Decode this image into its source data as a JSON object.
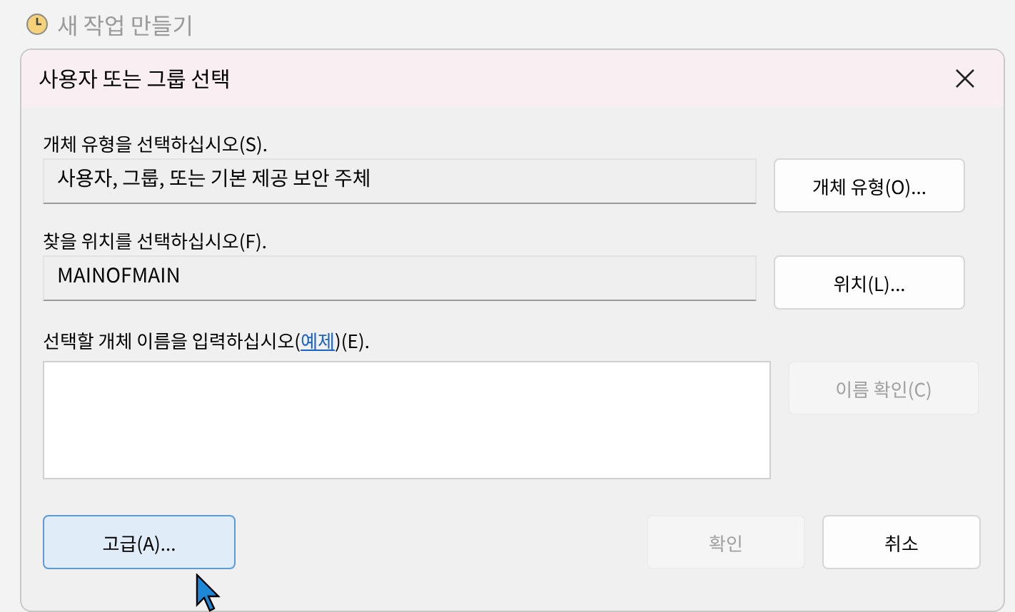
{
  "background_window": {
    "title": "새 작업 만들기"
  },
  "dialog": {
    "title": "사용자 또는 그룹 선택",
    "object_type": {
      "label": "개체 유형을 선택하십시오(S).",
      "value": "사용자, 그룹, 또는 기본 제공 보안 주체",
      "button": {
        "label": "개체 유형(O)...",
        "disabled": false
      }
    },
    "location": {
      "label": "찾을 위치를 선택하십시오(F).",
      "value": "MAINOFMAIN",
      "button": {
        "label": "위치(L)...",
        "disabled": false
      }
    },
    "object_names": {
      "label_before": "선택할 개체 이름을 입력하십시오(",
      "link": "예제",
      "label_after": ")(E).",
      "button": {
        "label": "이름 확인(C)",
        "disabled": true
      }
    },
    "buttons": [
      {
        "label": "고급(A)...",
        "disabled": false,
        "focused": true
      },
      {
        "label": "확인",
        "disabled": true,
        "focused": false
      },
      {
        "label": "취소",
        "disabled": false,
        "focused": false
      }
    ]
  }
}
